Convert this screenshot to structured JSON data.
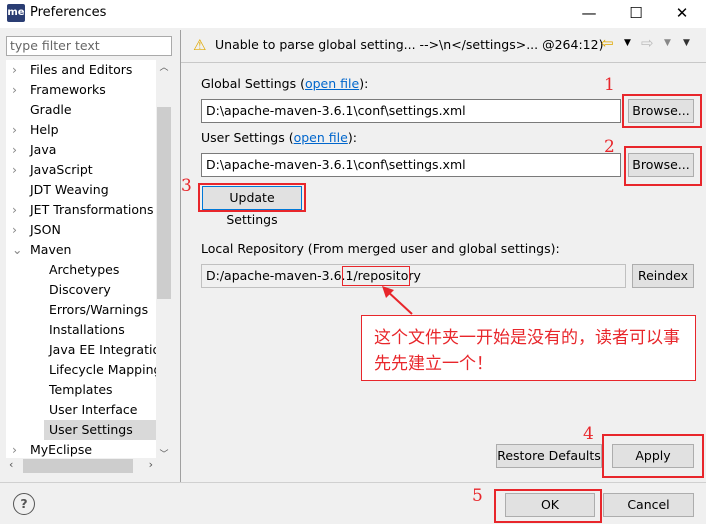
{
  "window": {
    "title": "Preferences",
    "logo": "me",
    "controls": [
      "minimize",
      "maximize",
      "close"
    ]
  },
  "sidebar": {
    "filter_placeholder": "type filter text",
    "items": [
      {
        "label": "Files and Editors",
        "expandable": true
      },
      {
        "label": "Frameworks",
        "expandable": true
      },
      {
        "label": "Gradle",
        "expandable": false
      },
      {
        "label": "Help",
        "expandable": true
      },
      {
        "label": "Java",
        "expandable": true
      },
      {
        "label": "JavaScript",
        "expandable": true
      },
      {
        "label": "JDT Weaving",
        "expandable": false
      },
      {
        "label": "JET Transformations",
        "expandable": true
      },
      {
        "label": "JSON",
        "expandable": true
      },
      {
        "label": "Maven",
        "expandable": true,
        "expanded": true
      },
      {
        "label": "Archetypes",
        "child": true
      },
      {
        "label": "Discovery",
        "child": true
      },
      {
        "label": "Errors/Warnings",
        "child": true
      },
      {
        "label": "Installations",
        "child": true
      },
      {
        "label": "Java EE Integration",
        "child": true
      },
      {
        "label": "Lifecycle Mappings",
        "child": true
      },
      {
        "label": "Templates",
        "child": true
      },
      {
        "label": "User Interface",
        "child": true
      },
      {
        "label": "User Settings",
        "child": true,
        "selected": true
      },
      {
        "label": "MyEclipse",
        "expandable": true
      }
    ]
  },
  "header": {
    "message": "Unable to parse global setting... -->\\n</settings>... @264:12)",
    "icon": "warning-icon"
  },
  "main": {
    "global_label": "Global Settings (",
    "global_link": "open file",
    "global_suffix": "):",
    "global_value": "D:\\apache-maven-3.6.1\\conf\\settings.xml",
    "user_label": "User Settings (",
    "user_link": "open file",
    "user_suffix": "):",
    "user_value": "D:\\apache-maven-3.6.1\\conf\\settings.xml",
    "browse": "Browse...",
    "update": "Update Settings",
    "local_label": "Local Repository (From merged user and global settings):",
    "local_value": "D:/apache-maven-3.6.1/repository",
    "reindex": "Reindex",
    "restore": "Restore Defaults",
    "apply": "Apply"
  },
  "annotations": {
    "n1": "1",
    "n2": "2",
    "n3": "3",
    "n4": "4",
    "n5": "5",
    "note": "这个文件夹一开始是没有的，读者可以事先先建立一个！"
  },
  "footer": {
    "ok": "OK",
    "cancel": "Cancel",
    "help": "?"
  }
}
